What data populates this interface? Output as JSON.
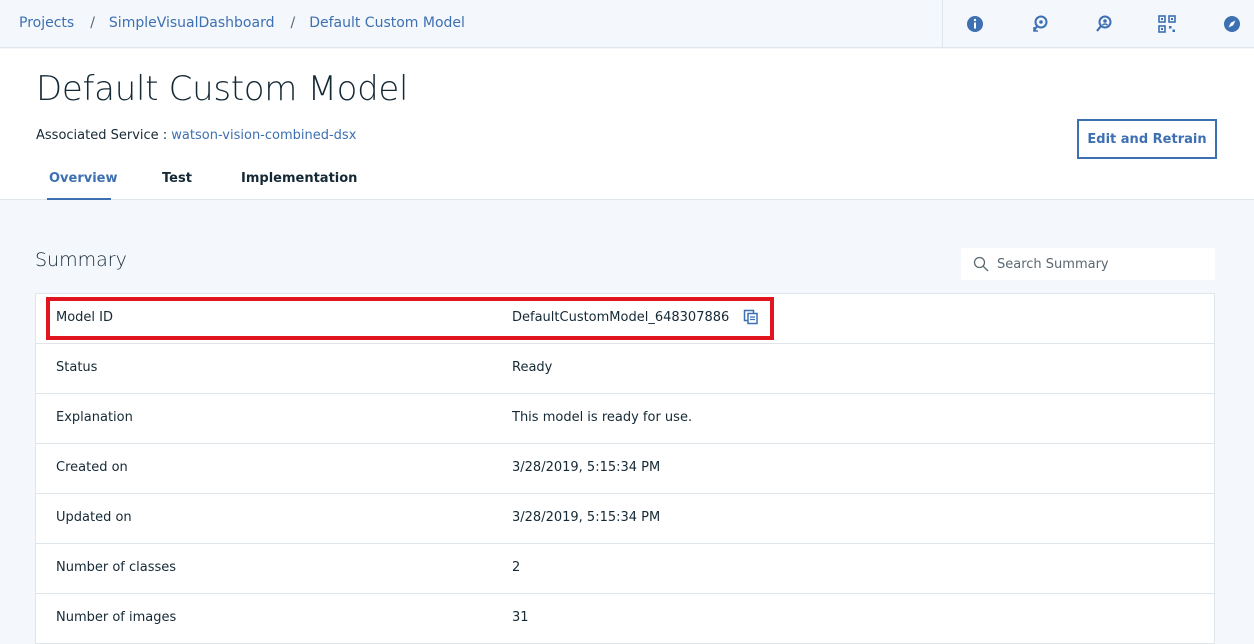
{
  "breadcrumb": {
    "items": [
      "Projects",
      "SimpleVisualDashboard",
      "Default Custom Model"
    ],
    "separator": "/"
  },
  "top_icons": [
    "info-icon",
    "feedback-icon",
    "search-person-icon",
    "apps-grid-icon",
    "compass-icon"
  ],
  "header": {
    "title": "Default Custom Model",
    "associated_label": "Associated Service :",
    "associated_link": "watson-vision-combined-dsx",
    "edit_button": "Edit and Retrain"
  },
  "tabs": [
    {
      "label": "Overview",
      "active": true
    },
    {
      "label": "Test",
      "active": false
    },
    {
      "label": "Implementation",
      "active": false
    }
  ],
  "summary": {
    "title": "Summary",
    "search_placeholder": "Search Summary",
    "rows": [
      {
        "key": "Model ID",
        "value": "DefaultCustomModel_648307886"
      },
      {
        "key": "Status",
        "value": "Ready"
      },
      {
        "key": "Explanation",
        "value": "This model is ready for use."
      },
      {
        "key": "Created on",
        "value": "3/28/2019, 5:15:34 PM"
      },
      {
        "key": "Updated on",
        "value": "3/28/2019, 5:15:34 PM"
      },
      {
        "key": "Number of classes",
        "value": "2"
      },
      {
        "key": "Number of images",
        "value": "31"
      }
    ]
  },
  "colors": {
    "accent": "#3d70b2",
    "highlight": "#e0151f",
    "text": "#152935"
  }
}
